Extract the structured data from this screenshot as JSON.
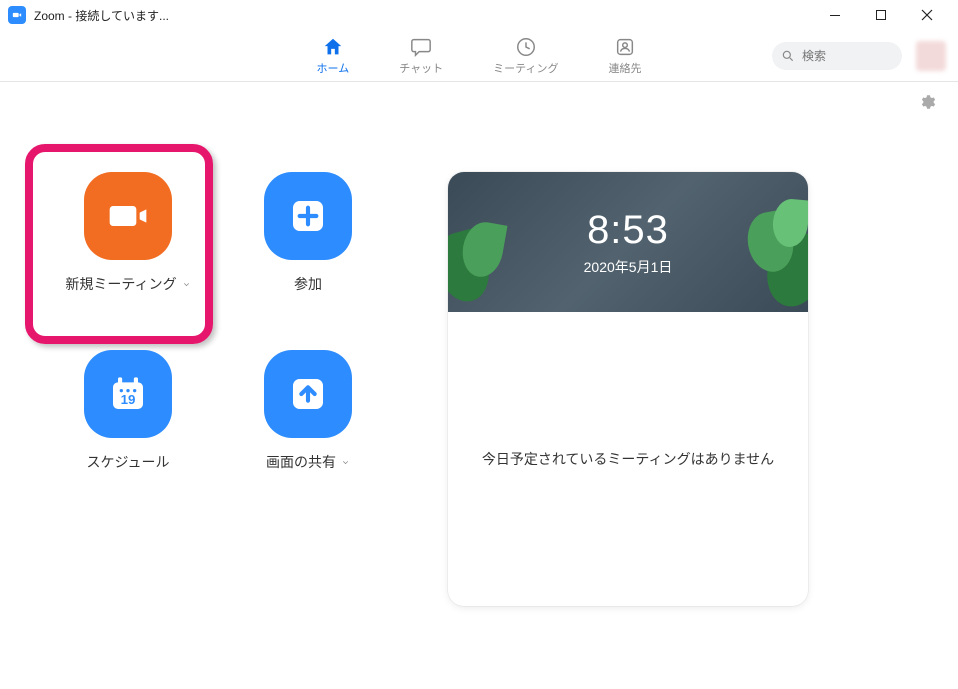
{
  "window": {
    "title": "Zoom - 接続しています..."
  },
  "nav": {
    "home": "ホーム",
    "chat": "チャット",
    "meeting": "ミーティング",
    "contacts": "連絡先"
  },
  "search": {
    "placeholder": "検索"
  },
  "tiles": {
    "new_meeting": {
      "label": "新規ミーティング"
    },
    "join": {
      "label": "参加"
    },
    "schedule": {
      "label": "スケジュール",
      "day": "19"
    },
    "share": {
      "label": "画面の共有"
    }
  },
  "panel": {
    "time": "8:53",
    "date": "2020年5月1日",
    "empty": "今日予定されているミーティングはありません"
  }
}
